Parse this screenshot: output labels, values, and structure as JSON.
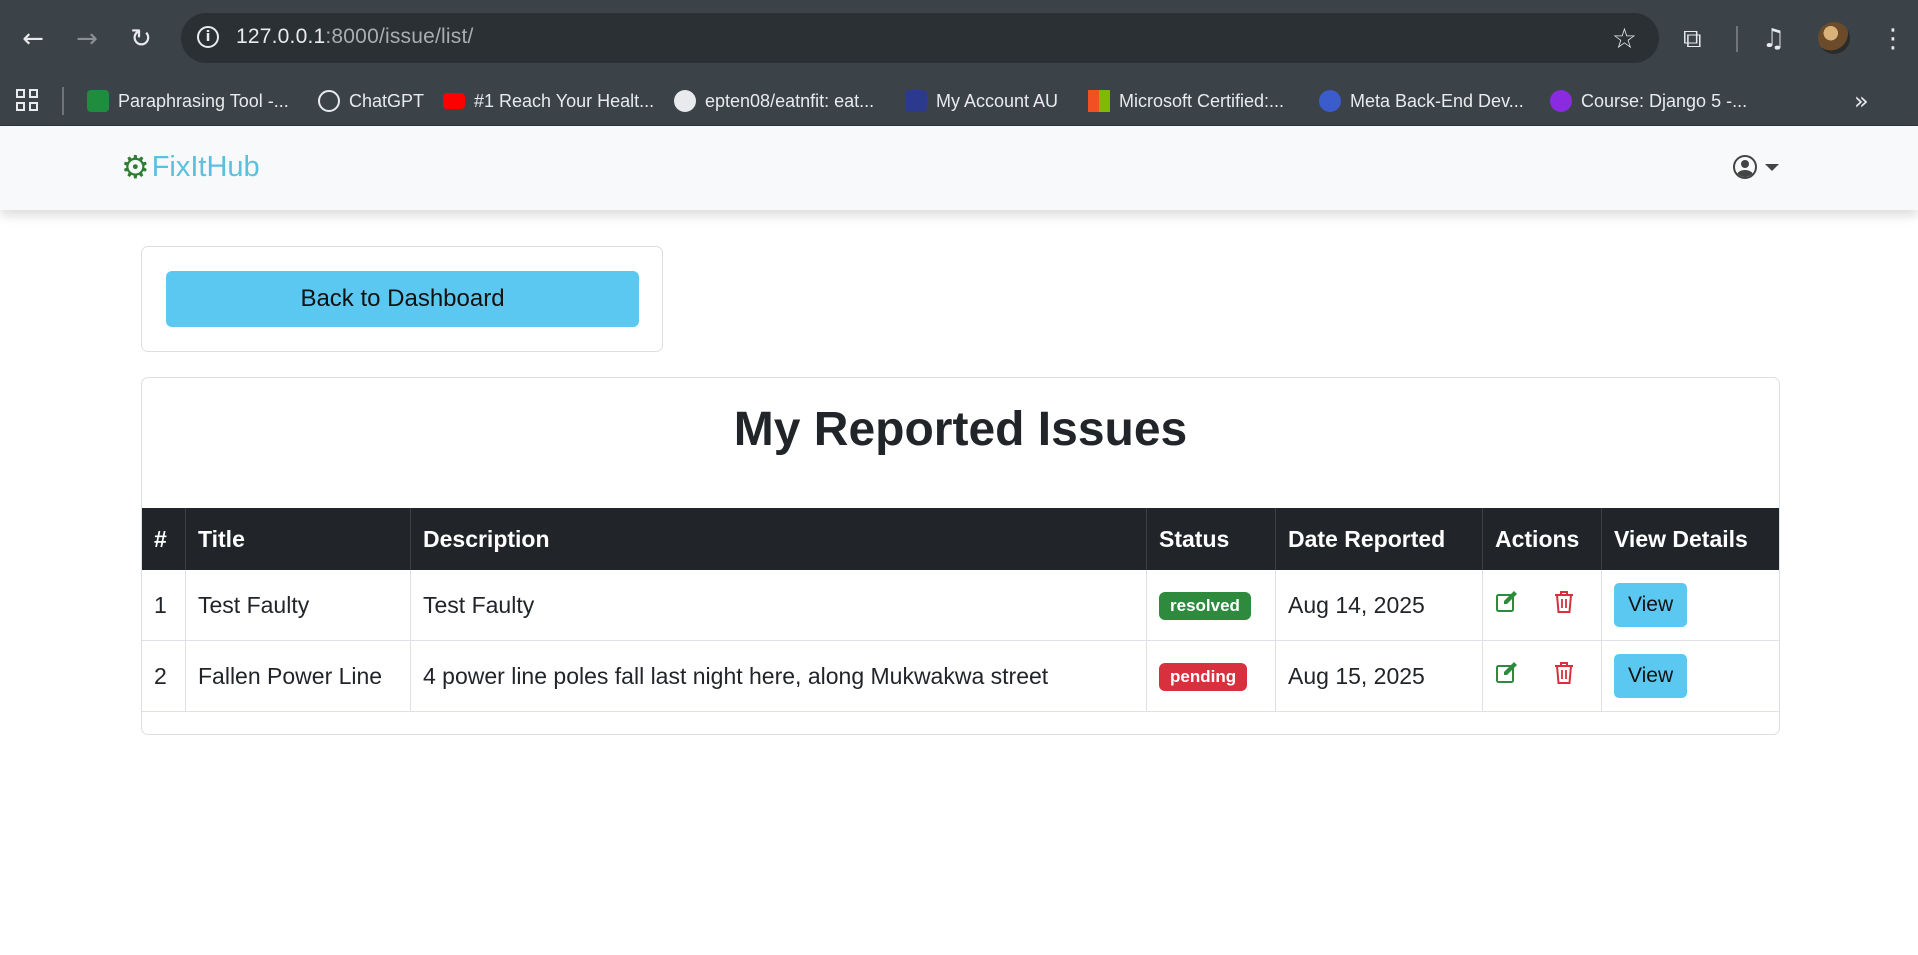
{
  "browser": {
    "url_host": "127.0.0.1",
    "url_rest": ":8000/issue/list/",
    "bookmarks": [
      {
        "label": "Paraphrasing Tool -...",
        "color": "#1e8e3e"
      },
      {
        "label": "ChatGPT",
        "color": "#3c4348"
      },
      {
        "label": "#1 Reach Your Healt...",
        "color": "#ff0000"
      },
      {
        "label": "epten08/eatnfit: eat...",
        "color": "#3c4348"
      },
      {
        "label": "My Account AU",
        "color": "#2b3a8c"
      },
      {
        "label": "Microsoft Certified:...",
        "color": "#f25022"
      },
      {
        "label": "Meta Back-End Dev...",
        "color": "#3a5ccc"
      },
      {
        "label": "Course: Django 5 -...",
        "color": "#8a2be2"
      }
    ]
  },
  "navbar": {
    "brand": "FixItHub",
    "brand_icon": "gear-icon",
    "user_icon": "user-circle-icon"
  },
  "back_button": {
    "label": "Back to Dashboard"
  },
  "issues": {
    "title": "My Reported Issues",
    "columns": [
      "#",
      "Title",
      "Description",
      "Status",
      "Date Reported",
      "Actions",
      "View Details"
    ],
    "rows": [
      {
        "num": "1",
        "title": "Test Faulty",
        "description": "Test Faulty",
        "status": "resolved",
        "status_color": "#2e8b3e",
        "date": "Aug 14, 2025",
        "view_label": "View"
      },
      {
        "num": "2",
        "title": "Fallen Power Line",
        "description": "4 power line poles fall last night here, along Mukwakwa street",
        "status": "pending",
        "status_color": "#d9303e",
        "date": "Aug 15, 2025",
        "view_label": "View"
      }
    ]
  }
}
